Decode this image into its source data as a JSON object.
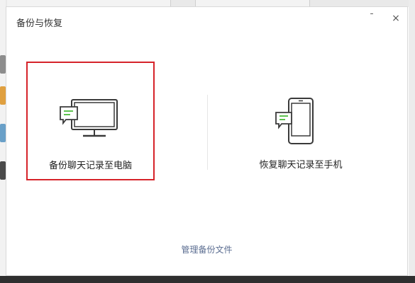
{
  "dialog": {
    "title": "备份与恢复",
    "minimize_glyph": "ˉ",
    "close_glyph": "×"
  },
  "options": [
    {
      "label": "备份聊天记录至电脑",
      "icon": "computer-with-chat-icon",
      "selected": true
    },
    {
      "label": "恢复聊天记录至手机",
      "icon": "phone-with-chat-icon",
      "selected": false
    }
  ],
  "manage_link": "管理备份文件",
  "colors": {
    "selection_border": "#d6232a",
    "chat_bubble": "#5ec24f",
    "link": "#5b6d91"
  }
}
